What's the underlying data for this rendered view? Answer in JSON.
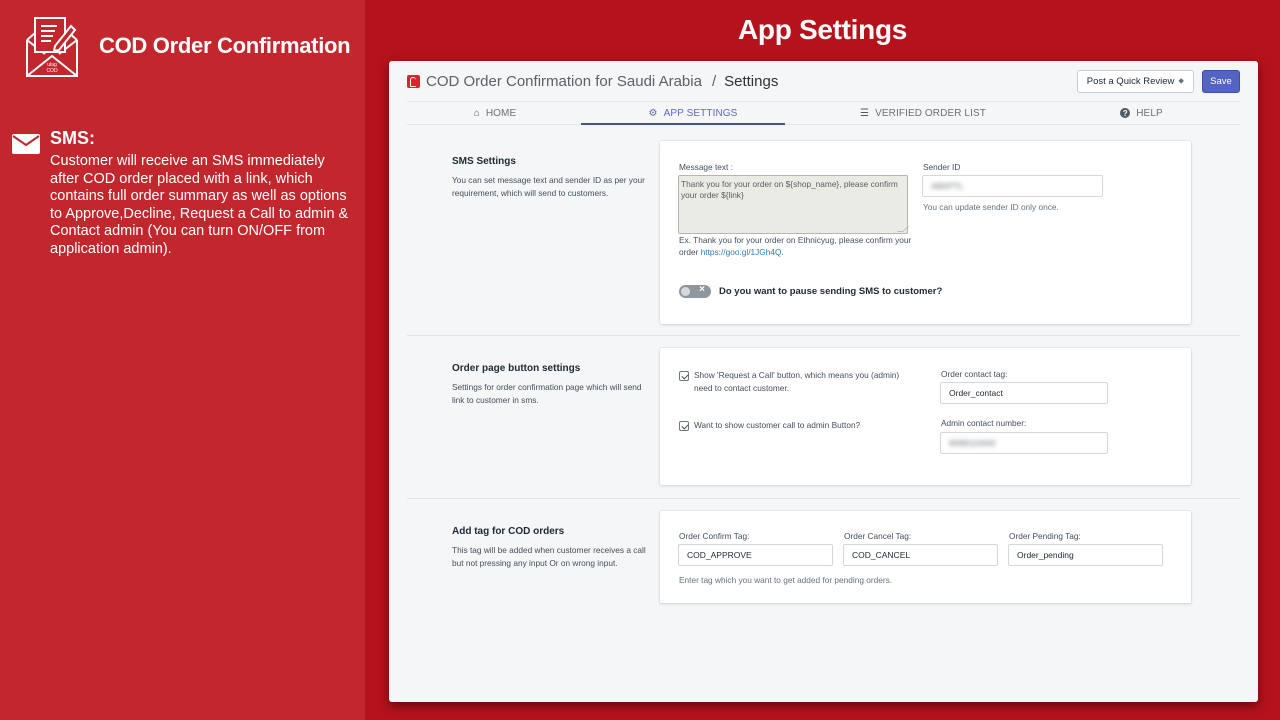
{
  "promo": {
    "brand_title": "COD Order Confirmation",
    "feature_title": "SMS:",
    "feature_desc": "Customer will receive an SMS immediately after COD order placed with a link, which contains full order summary as well as options to Approve,Decline, Request a Call to admin & Contact admin (You can turn ON/OFF from application admin)."
  },
  "page_heading": "App Settings",
  "header": {
    "app_name": "COD Order Confirmation for Saudi Arabia",
    "separator": "/",
    "current_page": "Settings",
    "review_button": "Post a Quick Review",
    "review_caret": "⬥",
    "save_button": "Save"
  },
  "tabs": [
    {
      "label": "HOME",
      "icon": "home-icon",
      "glyph": "⌂",
      "active": false
    },
    {
      "label": "APP SETTINGS",
      "icon": "gear-icon",
      "glyph": "⚙",
      "active": true
    },
    {
      "label": "VERIFIED ORDER LIST",
      "icon": "list-icon",
      "glyph": "☰",
      "active": false
    },
    {
      "label": "HELP",
      "icon": "help-icon",
      "glyph": "?",
      "active": false
    }
  ],
  "sms_settings": {
    "title": "SMS Settings",
    "description": "You can set message text and sender ID as per your requirement, which will send to customers.",
    "message_label": "Message text :",
    "message_value": "Thank you for your order on ${shop_name}, please confirm your order ${link}",
    "example_text": "Ex. Thank you for your order on Ethnicyug, please confirm your order ",
    "example_link": "https://goo.gl/1JGh4Q.",
    "sender_label": "Sender ID",
    "sender_value": "ABKPTL",
    "sender_help": "You can update sender ID only once.",
    "pause_label": "Do you want to pause sending SMS to customer?",
    "pause_enabled": false
  },
  "order_page_buttons": {
    "title": "Order page button settings",
    "description": "Settings for order confirmation page which will send link to customer in sms.",
    "request_call_label": "Show 'Request a Call' button, which means you (admin) need to contact customer.",
    "request_call_checked": true,
    "call_admin_label": "Want to show customer call to admin Button?",
    "call_admin_checked": true,
    "contact_tag_label": "Order contact tag:",
    "contact_tag_value": "Order_contact",
    "admin_number_label": "Admin contact number:",
    "admin_number_value": "9999110000"
  },
  "cod_tags": {
    "title": "Add tag for COD orders",
    "description": "This tag will be added when customer receives a call but not pressing any input Or on wrong input.",
    "confirm_label": "Order Confirm Tag:",
    "confirm_value": "COD_APPROVE",
    "cancel_label": "Order Cancel Tag:",
    "cancel_value": "COD_CANCEL",
    "pending_label": "Order Pending Tag:",
    "pending_value": "Order_pending",
    "help": "Enter tag which you want to get added for pending orders."
  }
}
